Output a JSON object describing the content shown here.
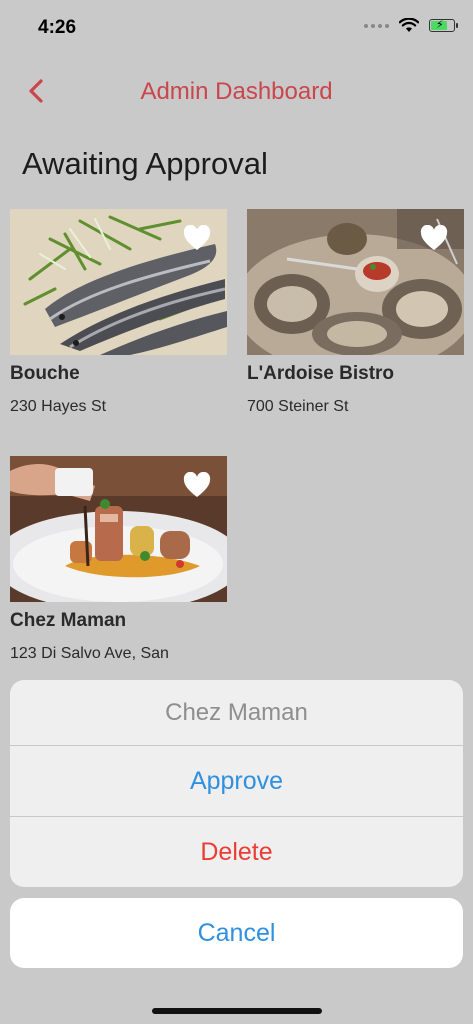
{
  "status_bar": {
    "time": "4:26"
  },
  "nav": {
    "title": "Admin Dashboard"
  },
  "section": {
    "title": "Awaiting Approval"
  },
  "restaurants": [
    {
      "name": "Bouche",
      "address": "230 Hayes St"
    },
    {
      "name": "L'Ardoise Bistro",
      "address": "700 Steiner St"
    },
    {
      "name": "Chez Maman",
      "address": "123 Di Salvo Ave, San"
    }
  ],
  "action_sheet": {
    "title": "Chez Maman",
    "approve_label": "Approve",
    "delete_label": "Delete",
    "cancel_label": "Cancel"
  },
  "colors": {
    "accent": "#c9464c",
    "action_blue": "#2f90e0",
    "destructive": "#ea3d35",
    "background": "#c9c9c9"
  },
  "icons": {
    "back": "chevron-left-icon",
    "favorite": "heart-icon",
    "wifi": "wifi-icon",
    "battery": "battery-icon"
  }
}
